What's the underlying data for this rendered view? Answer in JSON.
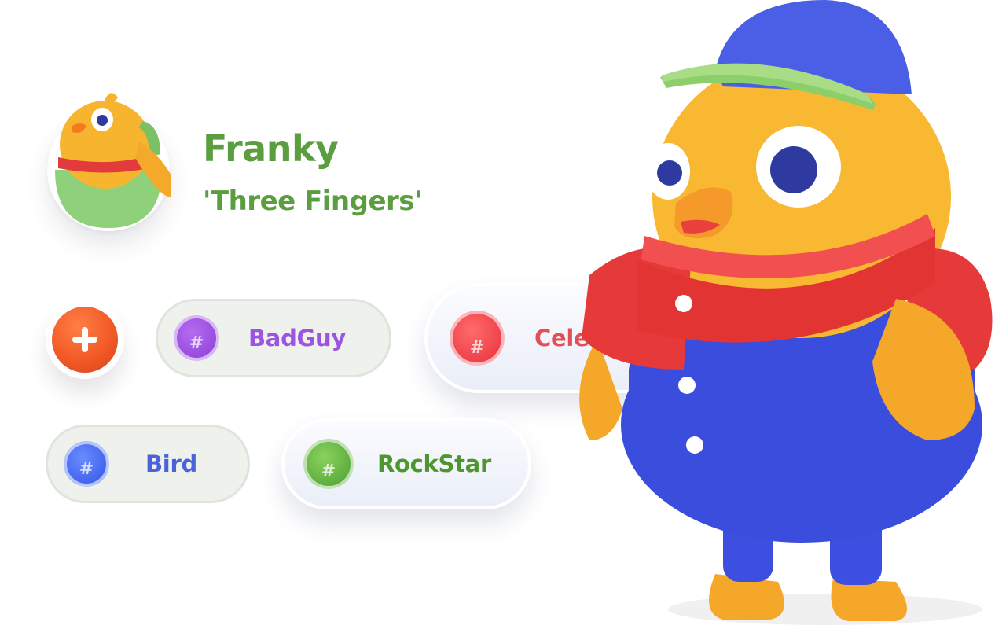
{
  "profile": {
    "name": "Franky",
    "nickname": "'Three Fingers'",
    "avatar_icon": "chick-avatar-icon"
  },
  "actions": {
    "add_icon": "plus-icon"
  },
  "tags": [
    {
      "label": "BadGuy",
      "symbol": "#",
      "color": "#9b55e0"
    },
    {
      "label": "Celebrity",
      "symbol": "#",
      "color": "#e34f58"
    },
    {
      "label": "Bird",
      "symbol": "#",
      "color": "#4a63d9"
    },
    {
      "label": "RockStar",
      "symbol": "#",
      "color": "#4e9630"
    }
  ],
  "theme": {
    "accent_green": "#5a9e3f",
    "add_orange": "#f25a27"
  }
}
